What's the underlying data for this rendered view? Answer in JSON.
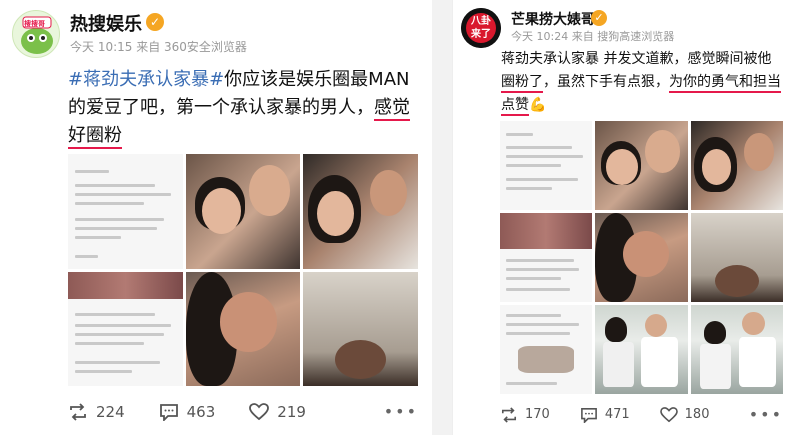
{
  "posts": [
    {
      "author": "热搜娱乐",
      "verified_mark": "✓",
      "avatar_label": "搜搜哥",
      "meta": "今天 10:15 来自 360安全浏览器",
      "text_hashtag": "#蒋劲夫承认家暴#",
      "text_body": "你应该是娱乐圈最MAN的爱豆了吧，第一个承认家暴的男人，",
      "text_highlight": "感觉好圈粉",
      "repost_count": "224",
      "comment_count": "463",
      "like_count": "219",
      "more": "•••"
    },
    {
      "author": "芒果捞大婊哥",
      "verified_mark": "✓",
      "avatar_label": "八卦来了",
      "meta": "今天 10:24 来自 搜狗高速浏览器",
      "text_body": "蒋劲夫承认家暴 并发文道歉，感觉瞬间被他",
      "text_highlight1": "圈粉了",
      "text_mid": "，虽然下手有点狠，",
      "text_highlight2": "为你的勇气和担当点赞",
      "text_emoji": "💪",
      "repost_count": "170",
      "comment_count": "471",
      "like_count": "180",
      "more": "•••"
    }
  ],
  "colors": {
    "hashtag": "#3a6db4",
    "underline": "#e5194b",
    "verified": "#f5a623",
    "meta": "#999999"
  },
  "icons": [
    "repost-icon",
    "comment-icon",
    "like-icon",
    "more-icon",
    "verified-icon"
  ]
}
